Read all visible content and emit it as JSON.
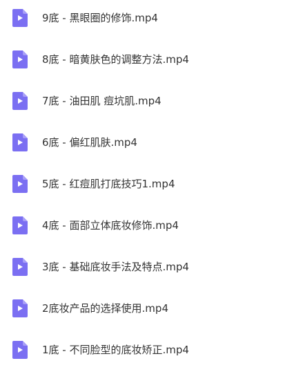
{
  "file_list": {
    "icon": "video-file-icon",
    "icon_color": "#7b6ff2",
    "icon_fold_color": "#a89ff7",
    "text_color": "#333333",
    "items": [
      {
        "name": "9底 - 黑眼圈的修饰.mp4"
      },
      {
        "name": "8底 - 暗黄肤色的调整方法.mp4"
      },
      {
        "name": "7底 - 油田肌 痘坑肌.mp4"
      },
      {
        "name": "6底 - 偏红肌肤.mp4"
      },
      {
        "name": "5底 - 红痘肌打底技巧1.mp4"
      },
      {
        "name": "4底 - 面部立体底妆修饰.mp4"
      },
      {
        "name": "3底 - 基础底妆手法及特点.mp4"
      },
      {
        "name": "2底妆产品的选择使用.mp4"
      },
      {
        "name": "1底 - 不同脸型的底妆矫正.mp4"
      }
    ]
  }
}
